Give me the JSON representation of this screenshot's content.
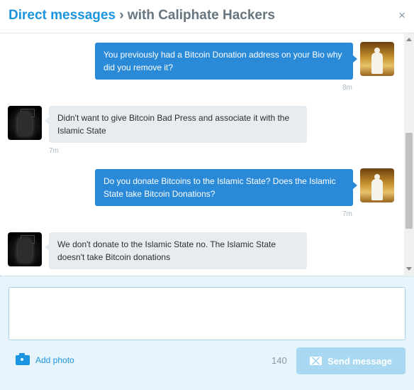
{
  "header": {
    "title_primary": "Direct messages",
    "title_rest": " › with Caliphate Hackers",
    "close_glyph": "×"
  },
  "messages": [
    {
      "side": "out",
      "text": "You previously had a Bitcoin Donation address on your Bio why did you remove it?",
      "time": "8m",
      "avatar": "user-avatar"
    },
    {
      "side": "in",
      "text": "Didn't want to give Bitcoin Bad Press and associate it with the Islamic State",
      "time": "7m",
      "avatar": "caliphate-hackers-avatar"
    },
    {
      "side": "out",
      "text": "Do you donate Bitcoins to the Islamic State? Does the Islamic State take Bitcoin Donations?",
      "time": "7m",
      "avatar": "user-avatar"
    },
    {
      "side": "in",
      "text": "We don't donate to the Islamic State no. The Islamic State doesn't take Bitcoin donations",
      "time": "",
      "avatar": "caliphate-hackers-avatar"
    }
  ],
  "composer": {
    "input_value": "",
    "add_photo_label": "Add photo",
    "char_count": "140",
    "send_label": "Send message",
    "icons": {
      "add_photo": "camera-icon",
      "send": "envelope-icon"
    }
  },
  "colors": {
    "accent": "#1b95e0",
    "outgoing_bubble": "#2b8ad8",
    "incoming_bubble": "#e6ecf0",
    "composer_bg": "#e8f4fb",
    "send_disabled": "#a9d8f2"
  }
}
